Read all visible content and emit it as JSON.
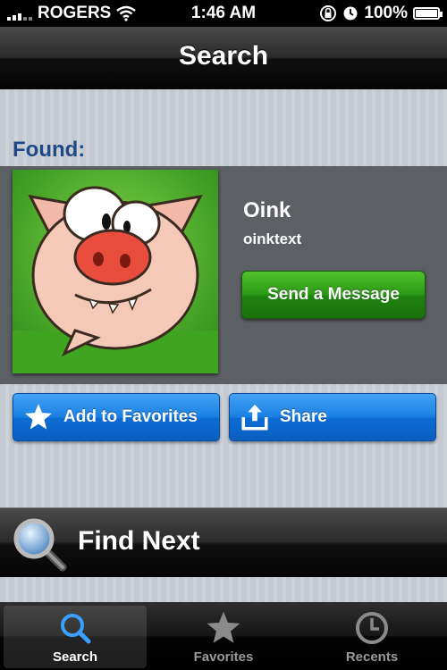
{
  "status_bar": {
    "carrier": "ROGERS",
    "time": "1:46 AM",
    "battery": "100%"
  },
  "nav": {
    "title": "Search"
  },
  "result": {
    "found_label": "Found:",
    "name": "Oink",
    "handle": "oinktext",
    "avatar_icon": "pig-avatar-icon",
    "send_label": "Send a Message"
  },
  "actions": {
    "favorite_label": "Add to Favorites",
    "share_label": "Share"
  },
  "find_next": {
    "label": "Find Next"
  },
  "tabs": [
    {
      "label": "Search",
      "icon": "search-icon",
      "active": true
    },
    {
      "label": "Favorites",
      "icon": "star-icon",
      "active": false
    },
    {
      "label": "Recents",
      "icon": "clock-icon",
      "active": false
    }
  ],
  "colors": {
    "send_button": "#2a9815",
    "action_button": "#1a7fe2",
    "found_label": "#1e4a86",
    "panel": "#5c5f63"
  }
}
